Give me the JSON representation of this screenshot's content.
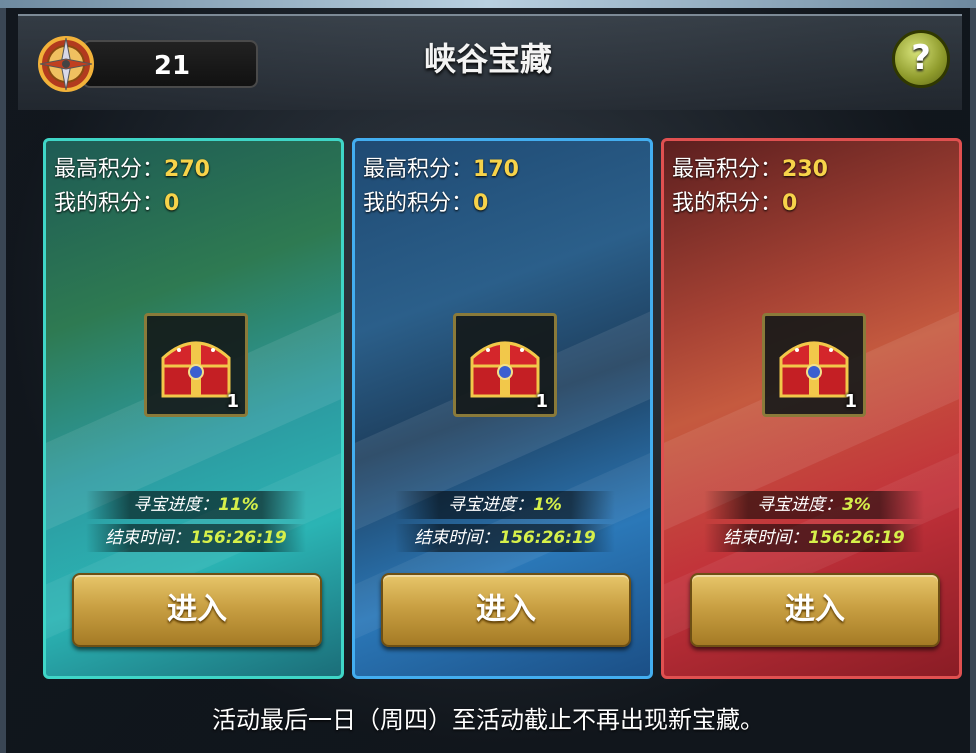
{
  "header": {
    "currency_value": "21",
    "title": "峡谷宝藏",
    "help_label": "?"
  },
  "cards": [
    {
      "theme": "green",
      "high_score_label": "最高积分：",
      "high_score": "270",
      "my_score_label": "我的积分：",
      "my_score": "0",
      "chest_count": "1",
      "progress_label": "寻宝进度：",
      "progress_value": "11%",
      "end_time_label": "结束时间：",
      "end_time_value": "156:26:19",
      "enter_label": "进入"
    },
    {
      "theme": "blue",
      "high_score_label": "最高积分：",
      "high_score": "170",
      "my_score_label": "我的积分：",
      "my_score": "0",
      "chest_count": "1",
      "progress_label": "寻宝进度：",
      "progress_value": "1%",
      "end_time_label": "结束时间：",
      "end_time_value": "156:26:19",
      "enter_label": "进入"
    },
    {
      "theme": "red",
      "high_score_label": "最高积分：",
      "high_score": "230",
      "my_score_label": "我的积分：",
      "my_score": "0",
      "chest_count": "1",
      "progress_label": "寻宝进度：",
      "progress_value": "3%",
      "end_time_label": "结束时间：",
      "end_time_value": "156:26:19",
      "enter_label": "进入"
    }
  ],
  "footer": {
    "notice": "活动最后一日（周四）至活动截止不再出现新宝藏。"
  },
  "icons": {
    "currency": "compass-icon",
    "help": "help-icon",
    "chest": "treasure-chest-icon"
  },
  "colors": {
    "score_value": "#f7d34a",
    "info_value": "#d6f04a",
    "green_border": "#3fd6c7",
    "blue_border": "#43aef0",
    "red_border": "#e05050"
  }
}
